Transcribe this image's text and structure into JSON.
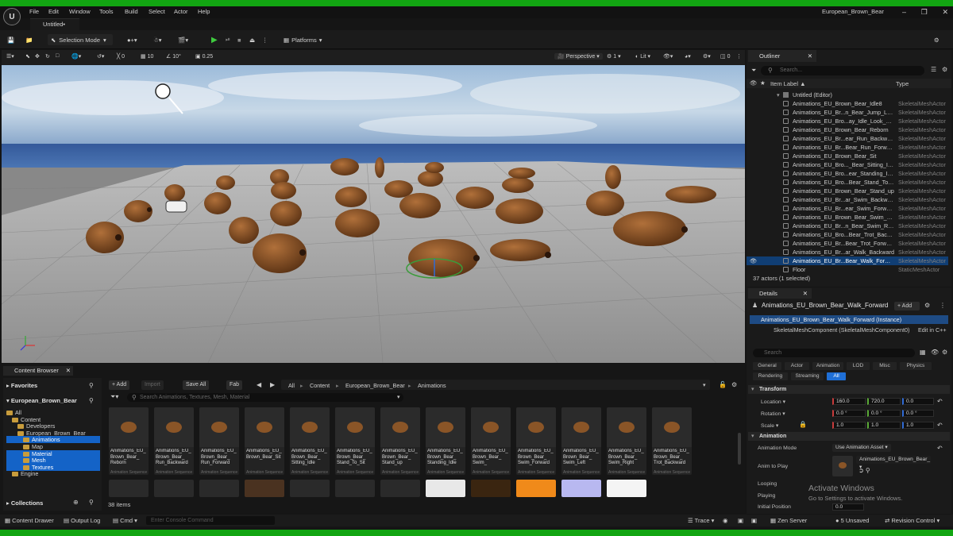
{
  "menu": [
    "File",
    "Edit",
    "Window",
    "Tools",
    "Build",
    "Select",
    "Actor",
    "Help"
  ],
  "project_name": "European_Brown_Bear",
  "level_tab": "Untitled•",
  "toolbar": {
    "selection_mode": "Selection Mode",
    "platforms": "Platforms"
  },
  "viewport_toolbar": {
    "rotate_snap": "0",
    "grid_snap": "10",
    "angle_snap": "10°",
    "scale_snap": "0.25",
    "view_mode": "Perspective",
    "camera_speed": "1",
    "lit": "Lit",
    "layers": "0"
  },
  "outliner": {
    "tab": "Outliner",
    "search_placeholder": "Search...",
    "col_label": "Item Label ▲",
    "col_type": "Type",
    "root": "Untitled (Editor)",
    "rows": [
      {
        "name": "Animations_EU_Brown_Bear_Idle8",
        "type": "SkeletalMeshActor"
      },
      {
        "name": "Animations_EU_Br...n_Bear_Jump_Land",
        "type": "SkeletalMeshActor"
      },
      {
        "name": "Animations_EU_Bro...ay_Idle_Look_Side",
        "type": "SkeletalMeshActor"
      },
      {
        "name": "Animations_EU_Brown_Bear_Reborn",
        "type": "SkeletalMeshActor"
      },
      {
        "name": "Animations_EU_Br...ear_Run_Backward",
        "type": "SkeletalMeshActor"
      },
      {
        "name": "Animations_EU_Br...Bear_Run_Forward",
        "type": "SkeletalMeshActor"
      },
      {
        "name": "Animations_EU_Brown_Bear_Sit",
        "type": "SkeletalMeshActor"
      },
      {
        "name": "Animations_EU_Bro..._Bear_Sitting_Idle",
        "type": "SkeletalMeshActor"
      },
      {
        "name": "Animations_EU_Bro...ear_Standing_Idle",
        "type": "SkeletalMeshActor"
      },
      {
        "name": "Animations_EU_Bro...Bear_Stand_To_Sit",
        "type": "SkeletalMeshActor"
      },
      {
        "name": "Animations_EU_Brown_Bear_Stand_up",
        "type": "SkeletalMeshActor"
      },
      {
        "name": "Animations_EU_Br...ar_Swim_Backward",
        "type": "SkeletalMeshActor"
      },
      {
        "name": "Animations_EU_Br...ear_Swim_Forward",
        "type": "SkeletalMeshActor"
      },
      {
        "name": "Animations_EU_Brown_Bear_Swim_Left",
        "type": "SkeletalMeshActor"
      },
      {
        "name": "Animations_EU_Br...n_Bear_Swim_Right",
        "type": "SkeletalMeshActor"
      },
      {
        "name": "Animations_EU_Bro...Bear_Trot_Backward",
        "type": "SkeletalMeshActor"
      },
      {
        "name": "Animations_EU_Br...Bear_Trot_Forward",
        "type": "SkeletalMeshActor"
      },
      {
        "name": "Animations_EU_Br...ar_Walk_Backward",
        "type": "SkeletalMeshActor"
      },
      {
        "name": "Animations_EU_Br...Bear_Walk_Forward",
        "type": "SkeletalMeshActor",
        "selected": true
      },
      {
        "name": "Floor",
        "type": "StaticMeshActor"
      }
    ],
    "footer": "37 actors (1 selected)"
  },
  "details": {
    "tab": "Details",
    "actor_name": "Animations_EU_Brown_Bear_Walk_Forward",
    "add_label": "+ Add",
    "instance": "Animations_EU_Brown_Bear_Walk_Forward (Instance)",
    "component": "SkeletalMeshComponent (SkeletalMeshComponent0)",
    "edit_cpp": "Edit in C++",
    "search_placeholder": "Search",
    "tabs_row1": [
      "General",
      "Actor",
      "Animation",
      "LOD",
      "Misc",
      "Physics"
    ],
    "tabs_row2": [
      "Rendering",
      "Streaming",
      "All"
    ],
    "transform_section": "Transform",
    "location_label": "Location",
    "rotation_label": "Rotation",
    "scale_label": "Scale",
    "location": [
      "160.0",
      "720.0",
      "0.0"
    ],
    "rotation": [
      "0.0 °",
      "0.0 °",
      "0.0 °"
    ],
    "scale": [
      "1.0",
      "1.0",
      "1.0"
    ],
    "animation_section": "Animation",
    "anim_mode_label": "Animation Mode",
    "anim_mode_value": "Use Animation Asset",
    "anim_to_play_label": "Anim to Play",
    "anim_to_play_value": "Animations_EU_Brown_Bear_",
    "looping_label": "Looping",
    "playing_label": "Playing",
    "initial_position_label": "Initial Position",
    "initial_position_value": "0.0"
  },
  "watermark": {
    "line1": "Activate Windows",
    "line2": "Go to Settings to activate Windows."
  },
  "content_browser": {
    "tab": "Content Browser",
    "add": "+ Add",
    "import": "Import",
    "save_all": "Save All",
    "fab": "Fab",
    "breadcrumb": [
      "All",
      "Content",
      "European_Brown_Bear",
      "Animations"
    ],
    "search_placeholder": "Search Animations, Textures, Mesh, Material",
    "favorites": "Favorites",
    "project": "European_Brown_Bear",
    "collections": "Collections",
    "tree": [
      {
        "label": "All",
        "indent": 0
      },
      {
        "label": "Content",
        "indent": 1
      },
      {
        "label": "Developers",
        "indent": 2
      },
      {
        "label": "European_Brown_Bear",
        "indent": 2
      },
      {
        "label": "Animations",
        "indent": 3,
        "selected": true
      },
      {
        "label": "Map",
        "indent": 3
      },
      {
        "label": "Material",
        "indent": 3,
        "selected": true
      },
      {
        "label": "Mesh",
        "indent": 3,
        "selected": true
      },
      {
        "label": "Textures",
        "indent": 3,
        "selected": true
      },
      {
        "label": "Engine",
        "indent": 1
      }
    ],
    "assets": [
      {
        "label": "Animations_EU_\nBrown_Bear_\nReborn",
        "type": "Animation Sequence"
      },
      {
        "label": "Animations_EU_\nBrown_Bear_\nRun_Backward",
        "type": "Animation Sequence"
      },
      {
        "label": "Animations_EU_\nBrown_Bear_\nRun_Forward",
        "type": "Animation Sequence"
      },
      {
        "label": "Animations_EU_\nBrown_Bear_Sit",
        "type": "Animation Sequence"
      },
      {
        "label": "Animations_EU_\nBrown_Bear_\nSitting_Idle",
        "type": "Animation Sequence"
      },
      {
        "label": "Animations_EU_\nBrown_Bear_\nStand_To_Sit",
        "type": "Animation Sequence"
      },
      {
        "label": "Animations_EU_\nBrown_Bear_\nStand_up",
        "type": "Animation Sequence"
      },
      {
        "label": "Animations_EU_\nBrown_Bear_\nStanding_Idle",
        "type": "Animation Sequence"
      },
      {
        "label": "Animations_EU_\nBrown_Bear_\nSwim_",
        "type": "Animation Sequence"
      },
      {
        "label": "Animations_EU_\nBrown_Bear_\nSwim_Forward",
        "type": "Animation Sequence"
      },
      {
        "label": "Animations_EU_\nBrown_Bear_\nSwim_Left",
        "type": "Animation Sequence"
      },
      {
        "label": "Animations_EU_\nBrown_Bear_\nSwim_Right",
        "type": "Animation Sequence"
      },
      {
        "label": "Animations_EU_\nBrown_Bear_\nTrot_Backward",
        "type": "Animation Sequence"
      }
    ],
    "item_count": "38 items"
  },
  "statusbar": {
    "content_drawer": "Content Drawer",
    "output_log": "Output Log",
    "cmd": "Cmd",
    "console_placeholder": "Enter Console Command",
    "trace": "Trace",
    "zen_server": "Zen Server",
    "unsaved": "5 Unsaved",
    "revision_control": "Revision Control"
  },
  "colors": {
    "selection_blue": "#103e74",
    "accent_blue": "#1f6fd6",
    "play_green": "#3fcb3f",
    "border_green": "#12a512"
  }
}
